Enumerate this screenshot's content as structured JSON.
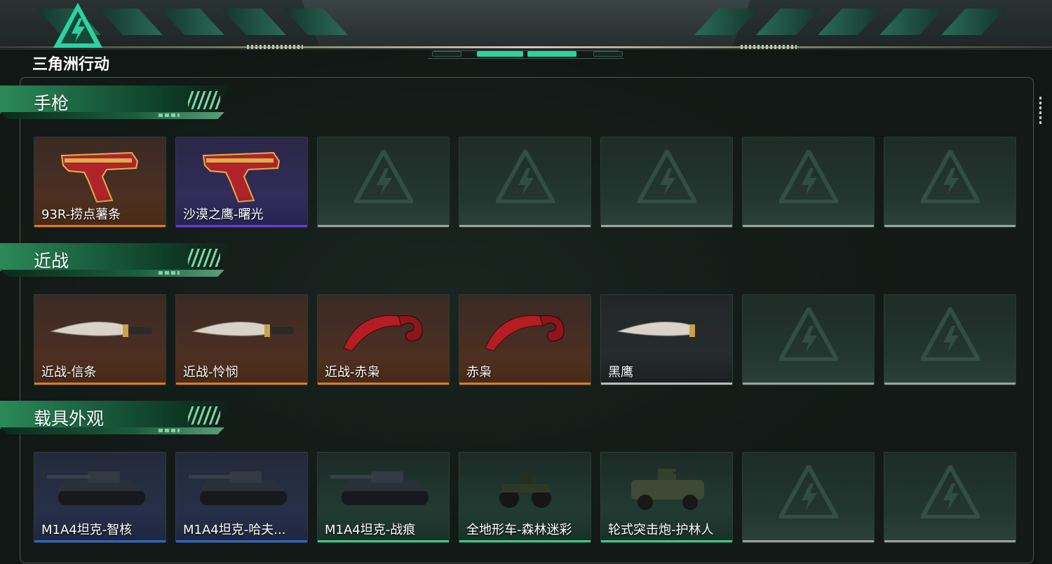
{
  "app": {
    "logo_text": "三角洲行动",
    "logo_icon": "delta-triangle-lightning-icon"
  },
  "colors": {
    "accent": "#2bd3a1",
    "rarity_gold": "#e07a1f",
    "rarity_purple": "#6b3ad6",
    "rarity_blue": "#2e63d6",
    "rarity_green": "#2fcf8d",
    "empty": "#9aa39f"
  },
  "sections": [
    {
      "title": "手枪",
      "items": [
        {
          "name": "93R-捞点薯条",
          "rarity": "gold",
          "icon": "pistol-icon"
        },
        {
          "name": "沙漠之鹰-曙光",
          "rarity": "purple",
          "icon": "pistol-icon"
        },
        {
          "name": "",
          "rarity": "empty"
        },
        {
          "name": "",
          "rarity": "empty"
        },
        {
          "name": "",
          "rarity": "empty"
        },
        {
          "name": "",
          "rarity": "empty"
        },
        {
          "name": "",
          "rarity": "empty"
        }
      ]
    },
    {
      "title": "近战",
      "items": [
        {
          "name": "近战-信条",
          "rarity": "gold",
          "icon": "knife-icon"
        },
        {
          "name": "近战-怜悯",
          "rarity": "gold",
          "icon": "knife-icon"
        },
        {
          "name": "近战-赤枭",
          "rarity": "gold",
          "icon": "karambit-icon"
        },
        {
          "name": "赤枭",
          "rarity": "gold",
          "icon": "karambit-icon"
        },
        {
          "name": "黑鹰",
          "rarity": "grey",
          "icon": "knife-icon"
        },
        {
          "name": "",
          "rarity": "empty"
        },
        {
          "name": "",
          "rarity": "empty"
        }
      ]
    },
    {
      "title": "载具外观",
      "items": [
        {
          "name": "M1A4坦克-智核",
          "rarity": "blue",
          "icon": "tank-icon"
        },
        {
          "name": "M1A4坦克-哈夫...",
          "rarity": "blue",
          "icon": "tank-icon"
        },
        {
          "name": "M1A4坦克-战痕",
          "rarity": "green",
          "icon": "tank-icon"
        },
        {
          "name": "全地形车-森林迷彩",
          "rarity": "green",
          "icon": "atv-icon"
        },
        {
          "name": "轮式突击炮-护林人",
          "rarity": "green",
          "icon": "armored-car-icon"
        },
        {
          "name": "",
          "rarity": "empty"
        },
        {
          "name": "",
          "rarity": "empty"
        }
      ]
    }
  ]
}
